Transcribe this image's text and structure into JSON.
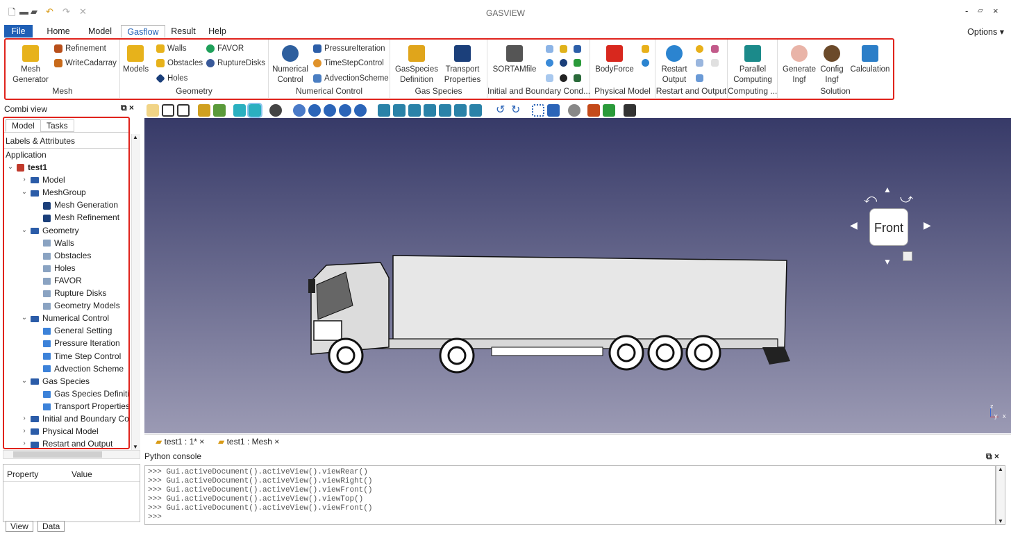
{
  "window": {
    "title": "GASVIEW",
    "minimize": "-",
    "restore": "ⓡ",
    "close": "×"
  },
  "quick_access": [
    "new-icon",
    "open-icon",
    "save-icon",
    "undo-icon",
    "redo-icon",
    "tools-icon"
  ],
  "menu": {
    "file": "File",
    "home": "Home",
    "model": "Model",
    "gasflow": "Gasflow",
    "result": "Result",
    "help": "Help",
    "options": "Options"
  },
  "ribbon": {
    "mesh": {
      "label": "Mesh",
      "generator": "Mesh\nGenerator",
      "refinement": "Refinement",
      "writecadarray": "WriteCadarray"
    },
    "geometry": {
      "label": "Geometry",
      "models": "Models",
      "walls": "Walls",
      "obstacles": "Obstacles",
      "holes": "Holes",
      "favor": "FAVOR",
      "rupture": "RuptureDisks"
    },
    "numerical": {
      "label": "Numerical Control",
      "control": "Numerical\nControl",
      "pressure": "PressureIteration",
      "timestep": "TimeStepControl",
      "advection": "AdvectionScheme"
    },
    "gasspecies": {
      "label": "Gas Species",
      "definition": "GasSpecies\nDefinition",
      "transport": "Transport\nProperties"
    },
    "initial": {
      "label": "Initial and Boundary Cond...",
      "sortam": "SORTAMfile"
    },
    "physical": {
      "label": "Physical Model",
      "bodyforce": "BodyForce"
    },
    "restart": {
      "label": "Restart and Output",
      "output": "Restart\nOutput"
    },
    "computing": {
      "label": "Computing ...",
      "parallel": "Parallel\nComputing"
    },
    "solution": {
      "label": "Solution",
      "generate": "Generate\nIngf",
      "config": "Config\nIngf",
      "calculation": "Calculation"
    }
  },
  "combi": {
    "title": "Combi view",
    "float": "ⓡ",
    "close": "×"
  },
  "tree_tabs": {
    "model": "Model",
    "tasks": "Tasks"
  },
  "tree_header": {
    "labels": "Labels & Attributes",
    "application": "Application"
  },
  "tree": [
    {
      "label": "test1",
      "level": 0,
      "kind": "doc",
      "expanded": true
    },
    {
      "label": "Model",
      "level": 1,
      "kind": "folder",
      "expanded": false
    },
    {
      "label": "MeshGroup",
      "level": 1,
      "kind": "folder",
      "expanded": true
    },
    {
      "label": "Mesh Generation",
      "level": 2,
      "kind": "cube"
    },
    {
      "label": "Mesh Refinement",
      "level": 2,
      "kind": "cube"
    },
    {
      "label": "Geometry",
      "level": 1,
      "kind": "folder",
      "expanded": true
    },
    {
      "label": "Walls",
      "level": 2,
      "kind": "grey"
    },
    {
      "label": "Obstacles",
      "level": 2,
      "kind": "grey"
    },
    {
      "label": "Holes",
      "level": 2,
      "kind": "grey"
    },
    {
      "label": "FAVOR",
      "level": 2,
      "kind": "grey"
    },
    {
      "label": "Rupture Disks",
      "level": 2,
      "kind": "grey"
    },
    {
      "label": "Geometry Models",
      "level": 2,
      "kind": "grey"
    },
    {
      "label": "Numerical Control",
      "level": 1,
      "kind": "folder",
      "expanded": true
    },
    {
      "label": "General Setting",
      "level": 2,
      "kind": "leaf"
    },
    {
      "label": "Pressure Iteration",
      "level": 2,
      "kind": "leaf"
    },
    {
      "label": "Time Step Control",
      "level": 2,
      "kind": "leaf"
    },
    {
      "label": "Advection Scheme",
      "level": 2,
      "kind": "leaf"
    },
    {
      "label": "Gas Species",
      "level": 1,
      "kind": "folder",
      "expanded": true
    },
    {
      "label": "Gas Species Definitio",
      "level": 2,
      "kind": "leaf"
    },
    {
      "label": "Transport Properties",
      "level": 2,
      "kind": "leaf"
    },
    {
      "label": "Initial and Boundary Cond",
      "level": 1,
      "kind": "folder",
      "expanded": false
    },
    {
      "label": "Physical Model",
      "level": 1,
      "kind": "folder",
      "expanded": false
    },
    {
      "label": "Restart and Output",
      "level": 1,
      "kind": "folder",
      "expanded": false
    }
  ],
  "property": {
    "col1": "Property",
    "col2": "Value"
  },
  "bottom_tabs": {
    "view": "View",
    "data": "Data"
  },
  "navcube": {
    "face": "Front"
  },
  "doc_tabs": [
    {
      "label": "test1 : 1*"
    },
    {
      "label": "test1 : Mesh"
    }
  ],
  "python": {
    "title": "Python console",
    "lines": [
      ">>> Gui.activeDocument().activeView().viewRear()",
      ">>> Gui.activeDocument().activeView().viewRight()",
      ">>> Gui.activeDocument().activeView().viewFront()",
      ">>> Gui.activeDocument().activeView().viewTop()",
      ">>> Gui.activeDocument().activeView().viewFront()",
      ">>>"
    ]
  },
  "axis": {
    "z": "z",
    "y": "y",
    "x": "x"
  }
}
